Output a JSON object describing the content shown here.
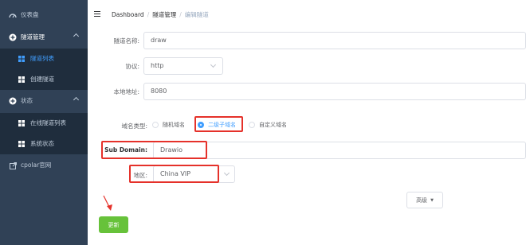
{
  "sidebar": {
    "items": [
      {
        "label": "仪表盘",
        "icon": "dashboard-icon"
      },
      {
        "label": "隧道管理",
        "icon": "plus-circle-icon"
      },
      {
        "label": "隧道列表",
        "icon": "grid-icon"
      },
      {
        "label": "创建隧道",
        "icon": "grid-icon"
      },
      {
        "label": "状态",
        "icon": "plus-circle-icon"
      },
      {
        "label": "在线隧道列表",
        "icon": "grid-icon"
      },
      {
        "label": "系统状态",
        "icon": "grid-icon"
      },
      {
        "label": "cpolar官网",
        "icon": "external-link-icon"
      }
    ]
  },
  "breadcrumb": {
    "home": "Dashboard",
    "section": "隧道管理",
    "current": "编辑隧道"
  },
  "form": {
    "tunnel_name_label": "隧道名称:",
    "tunnel_name_value": "draw",
    "protocol_label": "协议:",
    "protocol_value": "http",
    "local_address_label": "本地地址:",
    "local_address_value": "8080",
    "domain_type_label": "域名类型:",
    "domain_options": [
      "随机域名",
      "二级子域名",
      "自定义域名"
    ],
    "domain_selected": "二级子域名",
    "subdomain_label": "Sub Domain:",
    "subdomain_value": "Drawio",
    "region_label": "地区:",
    "region_value": "China VIP",
    "advanced_label": "高级",
    "update_label": "更新"
  },
  "colors": {
    "sidebar_bg": "#304156",
    "active": "#409eff",
    "highlight_box": "#e5312a",
    "update_button": "#67c23a"
  }
}
